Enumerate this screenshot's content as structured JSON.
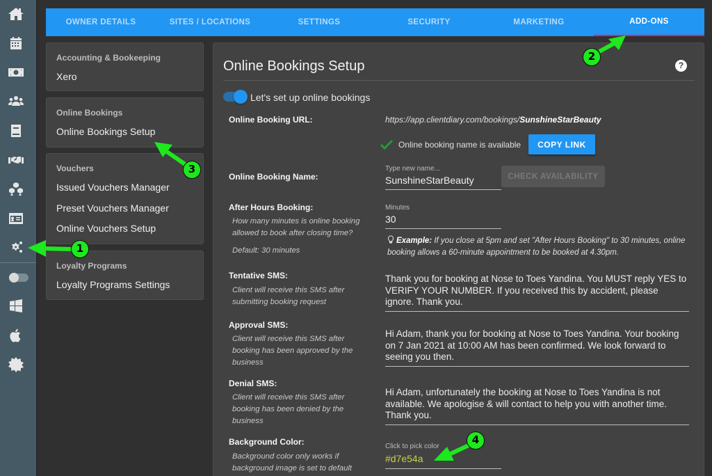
{
  "rail": {
    "items": [
      {
        "icon": "home-icon"
      },
      {
        "icon": "calendar-icon"
      },
      {
        "icon": "money-icon"
      },
      {
        "icon": "users-icon"
      },
      {
        "icon": "book-icon"
      },
      {
        "icon": "handshake-icon"
      },
      {
        "icon": "cubes-icon"
      },
      {
        "icon": "id-card-icon"
      },
      {
        "icon": "gears-icon"
      },
      {
        "icon": "toggle-icon"
      },
      {
        "icon": "windows-icon"
      },
      {
        "icon": "apple-icon"
      },
      {
        "icon": "theme-icon"
      }
    ]
  },
  "tabs": [
    {
      "label": "OWNER DETAILS",
      "active": false
    },
    {
      "label": "SITES / LOCATIONS",
      "active": false
    },
    {
      "label": "SETTINGS",
      "active": false
    },
    {
      "label": "SECURITY",
      "active": false
    },
    {
      "label": "MARKETING",
      "active": false
    },
    {
      "label": "ADD-ONS",
      "active": true
    }
  ],
  "menu": {
    "accounting": {
      "heading": "Accounting & Bookeeping",
      "items": [
        "Xero"
      ]
    },
    "online_bookings": {
      "heading": "Online Bookings",
      "items": [
        "Online Bookings Setup"
      ]
    },
    "vouchers": {
      "heading": "Vouchers",
      "items": [
        "Issued Vouchers Manager",
        "Preset Vouchers Manager",
        "Online Vouchers Setup"
      ]
    },
    "loyalty": {
      "heading": "Loyalty Programs",
      "items": [
        "Loyalty Programs Settings"
      ]
    }
  },
  "main": {
    "title": "Online Bookings Setup",
    "help_icon": "?",
    "toggle": {
      "label": "Let's set up online bookings",
      "on": true
    },
    "url": {
      "label": "Online Booking URL:",
      "prefix": "https://app.clientdiary.com/bookings/",
      "slug": "SunshineStarBeauty",
      "availability_text": "Online booking name is available",
      "copy_button": "COPY LINK"
    },
    "name": {
      "label": "Online Booking Name:",
      "input_label": "Type new name...",
      "value": "SunshineStarBeauty",
      "check_button": "CHECK AVAILABILITY"
    },
    "after_hours": {
      "label": "After Hours Booking:",
      "hint": "How many minutes is online booking allowed to book after closing time?",
      "default": "Default: 30 minutes",
      "input_label": "Minutes",
      "value": "30",
      "example_label": "Example:",
      "example_text": " If you close at 5pm and set \"After Hours Booking\" to 30 minutes, online booking allows a 60-minute appointment to be booked at 4.30pm."
    },
    "tentative": {
      "label": "Tentative SMS:",
      "hint": "Client will receive this SMS after submitting booking request",
      "value": "Thank you for booking at Nose to Toes Yandina. You MUST reply YES to VERIFY YOUR NUMBER. If you received this by accident, please ignore. Thank you."
    },
    "approval": {
      "label": "Approval SMS:",
      "hint": "Client will receive this SMS after booking has been approved by the business",
      "value": "Hi Adam, thank you for booking at Nose to Toes Yandina. Your booking on 7 Jan 2021 at 10:00 AM has been confirmed. We look forward to seeing you then."
    },
    "denial": {
      "label": "Denial SMS:",
      "hint": "Client will receive this SMS after booking has been denied by the business",
      "value": "Hi Adam, unfortunately the booking at Nose to Toes Yandina is not available. We apologise & will contact to help you with another time. Thank you."
    },
    "background": {
      "label": "Background Color:",
      "hint": "Background color only works if background image is set to default",
      "input_label": "Click to pick color",
      "value": "#d7e54a"
    }
  },
  "annotations": [
    "1",
    "2",
    "3",
    "4"
  ],
  "colors": {
    "accent": "#2196f3",
    "active_tab_indicator": "#e91e63",
    "rail": "#455a64",
    "annotation": "#1ee81e",
    "background_color_value": "#d7e54a"
  }
}
